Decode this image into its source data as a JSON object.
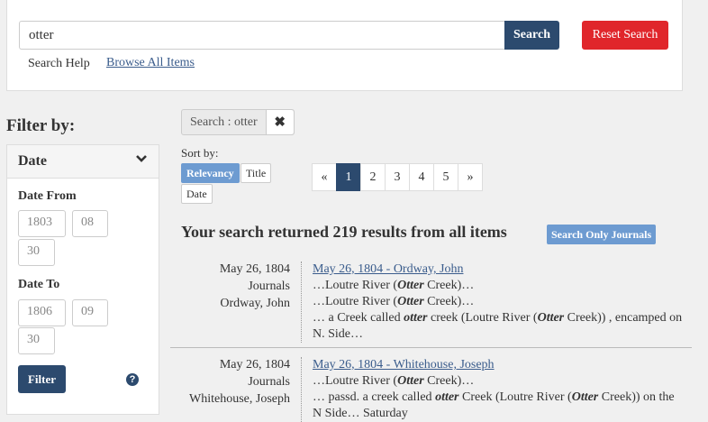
{
  "search": {
    "value": "otter",
    "button_label": "Search",
    "reset_label": "Reset Search",
    "help_label": "Search Help",
    "browse_label": "Browse All Items"
  },
  "filter": {
    "title": "Filter by:",
    "section": "Date",
    "date_from_label": "Date From",
    "from_year": "1803",
    "from_month": "08",
    "from_day": "30",
    "date_to_label": "Date To",
    "to_year": "1806",
    "to_month": "09",
    "to_day": "30",
    "button_label": "Filter",
    "help_icon": "?"
  },
  "chip": {
    "label": "Search : otter",
    "close": "✖"
  },
  "sort": {
    "label": "Sort by:",
    "options": [
      "Relevancy",
      "Title",
      "Date"
    ]
  },
  "pager": [
    "«",
    "1",
    "2",
    "3",
    "4",
    "5",
    "»"
  ],
  "results": {
    "heading": "Your search returned 219 results from all items",
    "journals_button": "Search Only Journals",
    "items": [
      {
        "date": "May 26, 1804",
        "type": "Journals",
        "author": "Ordway, John",
        "title": "May 26, 1804 - Ordway, John",
        "snippets": [
          [
            "…Loutre River (",
            "Otter",
            " Creek)…"
          ],
          [
            "…Loutre River (",
            "Otter",
            " Creek)…"
          ],
          [
            "… a Creek called ",
            "otter",
            " creek (Loutre River (",
            "Otter",
            " Creek)) , encamped on N. Side…"
          ]
        ]
      },
      {
        "date": "May 26, 1804",
        "type": "Journals",
        "author": "Whitehouse, Joseph",
        "title": "May 26, 1804 - Whitehouse, Joseph",
        "snippets": [
          [
            "…Loutre River (",
            "Otter",
            " Creek)…"
          ],
          [
            "… passd. a creek called ",
            "otter",
            " Creek (Loutre River (",
            "Otter",
            " Creek)) on the N Side… Saturday"
          ]
        ]
      }
    ]
  }
}
